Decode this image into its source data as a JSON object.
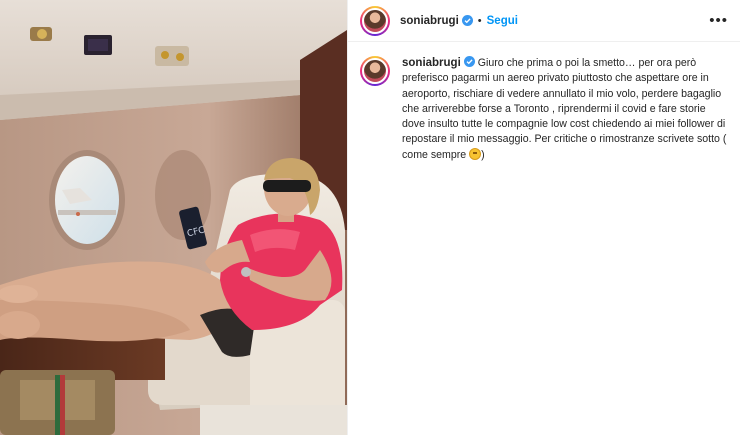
{
  "post": {
    "username": "soniabrugi",
    "follow_label": "Segui",
    "separator": "•",
    "more_label": "•••",
    "caption_text": "Giuro che prima o poi la smetto… per ora però preferisco pagarmi un aereo privato piuttosto che aspettare ore in aeroporto, rischiare di vedere annullato il mio volo, perdere bagaglio che arriverebbe forse a Toronto , riprendermi il covid e fare storie dove insulto tutte le compagnie low cost chiedendo ai miei follower di repostare il mio messaggio. Per critiche o rimostranze scrivete sotto ( come sempre ",
    "caption_end": ")"
  },
  "colors": {
    "link_blue": "#0095f6",
    "verified_blue": "#3897f0",
    "shirt_pink": "#e8345c"
  },
  "icons": {
    "verified": "verified-badge-icon",
    "more": "more-options-icon",
    "emoji": "smiling-face-emoji-icon"
  }
}
